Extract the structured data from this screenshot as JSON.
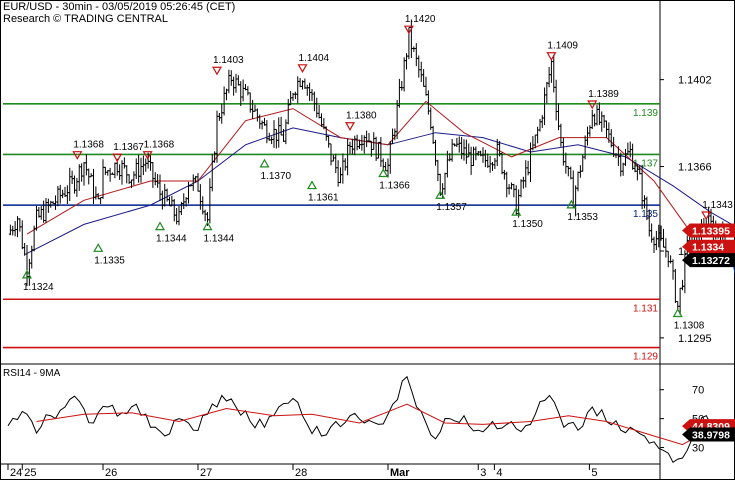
{
  "header": {
    "symbol_line": "EUR/USD - 30min - 03/05/2019 05:26:45 (CET)",
    "source_line": "Research © TRADING CENTRAL"
  },
  "chart_data": [
    {
      "type": "candlestick",
      "title": "EUR/USD - 30min",
      "x_labels": [
        {
          "label": "24",
          "day": 0
        },
        {
          "label": "25",
          "day": 0.15
        },
        {
          "label": "26",
          "day": 1
        },
        {
          "label": "27",
          "day": 2
        },
        {
          "label": "28",
          "day": 3
        },
        {
          "label": "Mar",
          "day": 4
        },
        {
          "label": "3",
          "day": 4.95
        },
        {
          "label": "4",
          "day": 5.12
        },
        {
          "label": "5",
          "day": 6.12
        }
      ],
      "y_ticks": [
        1.1402,
        1.1366,
        1.1331,
        1.1295
      ],
      "ylim": [
        1.1285,
        1.1435
      ],
      "price_series": [
        [
          0.0,
          1.1338
        ],
        [
          0.1,
          1.1345
        ],
        [
          0.2,
          1.1324
        ],
        [
          0.3,
          1.1344
        ],
        [
          0.5,
          1.1352
        ],
        [
          0.7,
          1.136
        ],
        [
          0.8,
          1.1368
        ],
        [
          0.95,
          1.135
        ],
        [
          1.0,
          1.1363
        ],
        [
          1.15,
          1.1367
        ],
        [
          1.3,
          1.1362
        ],
        [
          1.45,
          1.1368
        ],
        [
          1.6,
          1.1355
        ],
        [
          1.8,
          1.1344
        ],
        [
          1.9,
          1.136
        ],
        [
          2.0,
          1.1358
        ],
        [
          2.1,
          1.1344
        ],
        [
          2.2,
          1.1385
        ],
        [
          2.35,
          1.1403
        ],
        [
          2.5,
          1.1395
        ],
        [
          2.7,
          1.1382
        ],
        [
          2.9,
          1.1378
        ],
        [
          3.0,
          1.1398
        ],
        [
          3.1,
          1.1404
        ],
        [
          3.25,
          1.139
        ],
        [
          3.4,
          1.137
        ],
        [
          3.5,
          1.1361
        ],
        [
          3.6,
          1.1375
        ],
        [
          3.75,
          1.138
        ],
        [
          3.9,
          1.1372
        ],
        [
          4.0,
          1.1366
        ],
        [
          4.12,
          1.1395
        ],
        [
          4.22,
          1.142
        ],
        [
          4.35,
          1.1402
        ],
        [
          4.45,
          1.1385
        ],
        [
          4.55,
          1.1357
        ],
        [
          4.7,
          1.1375
        ],
        [
          4.85,
          1.137
        ],
        [
          5.0,
          1.1368
        ],
        [
          5.15,
          1.1372
        ],
        [
          5.35,
          1.135
        ],
        [
          5.5,
          1.137
        ],
        [
          5.6,
          1.1384
        ],
        [
          5.72,
          1.1409
        ],
        [
          5.82,
          1.1375
        ],
        [
          5.95,
          1.1353
        ],
        [
          6.05,
          1.137
        ],
        [
          6.15,
          1.1389
        ],
        [
          6.3,
          1.138
        ],
        [
          6.45,
          1.1368
        ],
        [
          6.55,
          1.1372
        ],
        [
          6.65,
          1.136
        ],
        [
          6.75,
          1.134
        ],
        [
          6.85,
          1.1335
        ],
        [
          6.95,
          1.133
        ],
        [
          7.05,
          1.1308
        ],
        [
          7.15,
          1.1332
        ],
        [
          7.25,
          1.1335
        ],
        [
          7.35,
          1.1343
        ],
        [
          7.5,
          1.1338
        ],
        [
          7.62,
          1.1332
        ]
      ],
      "ma_fast": [
        [
          0.2,
          1.1338
        ],
        [
          0.8,
          1.1352
        ],
        [
          1.5,
          1.136
        ],
        [
          2.0,
          1.136
        ],
        [
          2.5,
          1.1385
        ],
        [
          3.0,
          1.139
        ],
        [
          3.5,
          1.1378
        ],
        [
          4.0,
          1.1375
        ],
        [
          4.4,
          1.1393
        ],
        [
          4.8,
          1.138
        ],
        [
          5.3,
          1.137
        ],
        [
          5.8,
          1.1378
        ],
        [
          6.3,
          1.1378
        ],
        [
          6.8,
          1.136
        ],
        [
          7.2,
          1.1338
        ],
        [
          7.62,
          1.1338
        ]
      ],
      "ma_slow": [
        [
          0.2,
          1.133
        ],
        [
          0.8,
          1.1342
        ],
        [
          1.5,
          1.135
        ],
        [
          2.0,
          1.136
        ],
        [
          2.5,
          1.1375
        ],
        [
          3.0,
          1.1382
        ],
        [
          3.5,
          1.1378
        ],
        [
          4.0,
          1.1375
        ],
        [
          4.5,
          1.138
        ],
        [
          5.0,
          1.1378
        ],
        [
          5.5,
          1.1372
        ],
        [
          6.0,
          1.1375
        ],
        [
          6.5,
          1.137
        ],
        [
          7.0,
          1.1358
        ],
        [
          7.4,
          1.1347
        ],
        [
          7.62,
          1.1342
        ]
      ],
      "forecast_arrow": [
        [
          7.62,
          1.133
        ],
        [
          7.8,
          1.129
        ]
      ],
      "levels": [
        {
          "value": 1.1392,
          "label": "1.139",
          "color": "#1f8a1f"
        },
        {
          "value": 1.1371,
          "label": "1.137",
          "color": "#1f8a1f"
        },
        {
          "value": 1.135,
          "label": "1.135",
          "color": "#00208a"
        },
        {
          "value": 1.1311,
          "label": "1.131",
          "color": "#cc1111"
        },
        {
          "value": 1.1291,
          "label": "1.129",
          "color": "#cc1111"
        }
      ],
      "current_price_tags": [
        {
          "label": "1.13395",
          "value": 1.13395,
          "color": "#cc1111"
        },
        {
          "label": "1.1334",
          "value": 1.1334,
          "color": "#cc1111"
        },
        {
          "label": "1.13272",
          "value": 1.13272,
          "color": "#000000"
        }
      ],
      "annotations": [
        {
          "label": "1.1324",
          "day": 0.2,
          "value": 1.1324,
          "kind": "low"
        },
        {
          "label": "1.1335",
          "day": 0.95,
          "value": 1.1335,
          "kind": "low"
        },
        {
          "label": "1.1368",
          "day": 0.73,
          "value": 1.1368,
          "kind": "high"
        },
        {
          "label": "1.1367",
          "day": 1.15,
          "value": 1.1367,
          "kind": "high"
        },
        {
          "label": "1.1368",
          "day": 1.47,
          "value": 1.1368,
          "kind": "high"
        },
        {
          "label": "1.1344",
          "day": 1.6,
          "value": 1.1344,
          "kind": "low"
        },
        {
          "label": "1.1344",
          "day": 2.1,
          "value": 1.1344,
          "kind": "low"
        },
        {
          "label": "1.1403",
          "day": 2.2,
          "value": 1.1403,
          "kind": "high"
        },
        {
          "label": "1.1370",
          "day": 2.7,
          "value": 1.137,
          "kind": "low"
        },
        {
          "label": "1.1404",
          "day": 3.1,
          "value": 1.1404,
          "kind": "high"
        },
        {
          "label": "1.1361",
          "day": 3.2,
          "value": 1.1361,
          "kind": "low"
        },
        {
          "label": "1.1380",
          "day": 3.6,
          "value": 1.138,
          "kind": "high"
        },
        {
          "label": "1.1366",
          "day": 3.95,
          "value": 1.1366,
          "kind": "low"
        },
        {
          "label": "1.1420",
          "day": 4.22,
          "value": 1.142,
          "kind": "high"
        },
        {
          "label": "1.1357",
          "day": 4.55,
          "value": 1.1357,
          "kind": "low"
        },
        {
          "label": "1.1350",
          "day": 5.35,
          "value": 1.135,
          "kind": "low"
        },
        {
          "label": "1.1409",
          "day": 5.72,
          "value": 1.1409,
          "kind": "high"
        },
        {
          "label": "1.1353",
          "day": 5.93,
          "value": 1.1353,
          "kind": "low"
        },
        {
          "label": "1.1389",
          "day": 6.15,
          "value": 1.1389,
          "kind": "high"
        },
        {
          "label": "1.1308",
          "day": 7.05,
          "value": 1.1308,
          "kind": "low"
        },
        {
          "label": "1.1343",
          "day": 7.35,
          "value": 1.1343,
          "kind": "high"
        },
        {
          "label": "1.1323",
          "day": 7.7,
          "value": 1.1323,
          "kind": "target"
        }
      ]
    },
    {
      "type": "line",
      "title": "RSI14 - 9MA",
      "y_ticks": [
        70,
        50,
        30
      ],
      "ylim": [
        20,
        85
      ],
      "series": [
        {
          "color": "#000000",
          "values": [
            [
              0.0,
              45
            ],
            [
              0.15,
              55
            ],
            [
              0.3,
              40
            ],
            [
              0.45,
              52
            ],
            [
              0.6,
              58
            ],
            [
              0.75,
              62
            ],
            [
              0.9,
              47
            ],
            [
              1.05,
              58
            ],
            [
              1.2,
              54
            ],
            [
              1.35,
              60
            ],
            [
              1.5,
              44
            ],
            [
              1.65,
              38
            ],
            [
              1.8,
              50
            ],
            [
              1.95,
              42
            ],
            [
              2.1,
              53
            ],
            [
              2.25,
              66
            ],
            [
              2.4,
              58
            ],
            [
              2.55,
              48
            ],
            [
              2.7,
              44
            ],
            [
              2.85,
              58
            ],
            [
              3.0,
              64
            ],
            [
              3.15,
              46
            ],
            [
              3.3,
              38
            ],
            [
              3.45,
              48
            ],
            [
              3.6,
              52
            ],
            [
              3.75,
              47
            ],
            [
              3.9,
              46
            ],
            [
              4.05,
              60
            ],
            [
              4.2,
              79
            ],
            [
              4.35,
              55
            ],
            [
              4.5,
              36
            ],
            [
              4.65,
              50
            ],
            [
              4.8,
              52
            ],
            [
              4.95,
              42
            ],
            [
              5.1,
              48
            ],
            [
              5.25,
              46
            ],
            [
              5.4,
              41
            ],
            [
              5.55,
              53
            ],
            [
              5.7,
              66
            ],
            [
              5.85,
              44
            ],
            [
              6.0,
              42
            ],
            [
              6.15,
              58
            ],
            [
              6.3,
              48
            ],
            [
              6.45,
              42
            ],
            [
              6.6,
              42
            ],
            [
              6.75,
              33
            ],
            [
              6.9,
              28
            ],
            [
              7.05,
              22
            ],
            [
              7.2,
              36
            ],
            [
              7.35,
              52
            ],
            [
              7.5,
              44
            ],
            [
              7.62,
              39
            ]
          ]
        },
        {
          "color": "#cc1111",
          "values": [
            [
              0.3,
              48
            ],
            [
              0.8,
              53
            ],
            [
              1.3,
              54
            ],
            [
              1.8,
              48
            ],
            [
              2.3,
              57
            ],
            [
              2.8,
              52
            ],
            [
              3.2,
              53
            ],
            [
              3.7,
              47
            ],
            [
              4.2,
              60
            ],
            [
              4.6,
              47
            ],
            [
              5.0,
              46
            ],
            [
              5.5,
              48
            ],
            [
              5.9,
              52
            ],
            [
              6.3,
              48
            ],
            [
              6.8,
              38
            ],
            [
              7.1,
              32
            ],
            [
              7.4,
              43
            ],
            [
              7.62,
              44
            ]
          ]
        }
      ],
      "current_value_tags": [
        {
          "label": "44.8309",
          "value": 44.8309,
          "color": "#cc1111"
        },
        {
          "label": "38.9798",
          "value": 38.9798,
          "color": "#000000"
        }
      ]
    }
  ]
}
